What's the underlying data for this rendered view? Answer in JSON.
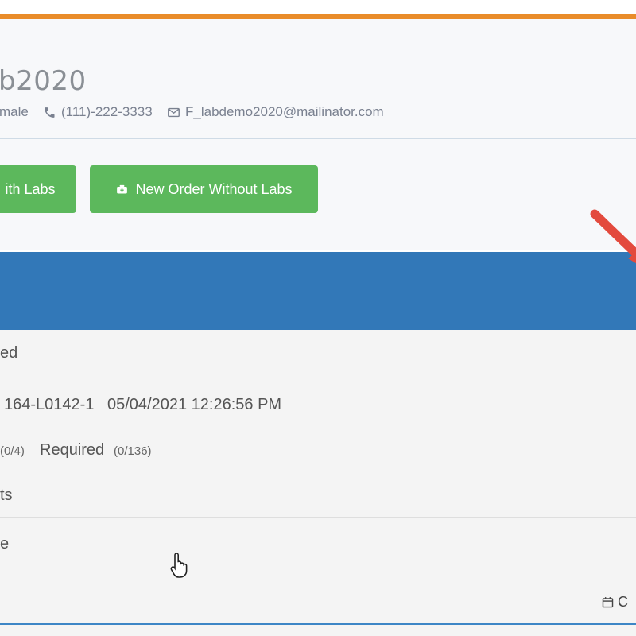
{
  "patient": {
    "name": "b2020",
    "gender": "male",
    "phone": "(111)-222-3333",
    "email": "F_labdemo2020@mailinator.com"
  },
  "actions": {
    "with_labs_label": "ith Labs",
    "without_labs_label": "New Order Without Labs"
  },
  "list": {
    "row1": "ed",
    "row2": {
      "order_id": "164-L0142-1",
      "datetime": "05/04/2021 12:26:56 PM",
      "optional_count": "(0/4)",
      "required_label": "Required",
      "required_count": "(0/136)",
      "extra_text": "ts"
    },
    "row3": "e",
    "row4": {
      "calendar_icon_text": "C"
    }
  },
  "colors": {
    "orange_bar": "#e98c2a",
    "green_button": "#5cb85c",
    "blue_band": "#3278b8"
  },
  "icons": {
    "phone": "phone-icon",
    "email": "envelope-icon",
    "medkit": "medkit-icon",
    "calendar": "calendar-icon",
    "annotation": "arrow-icon",
    "cursor": "hand-pointer-icon"
  }
}
